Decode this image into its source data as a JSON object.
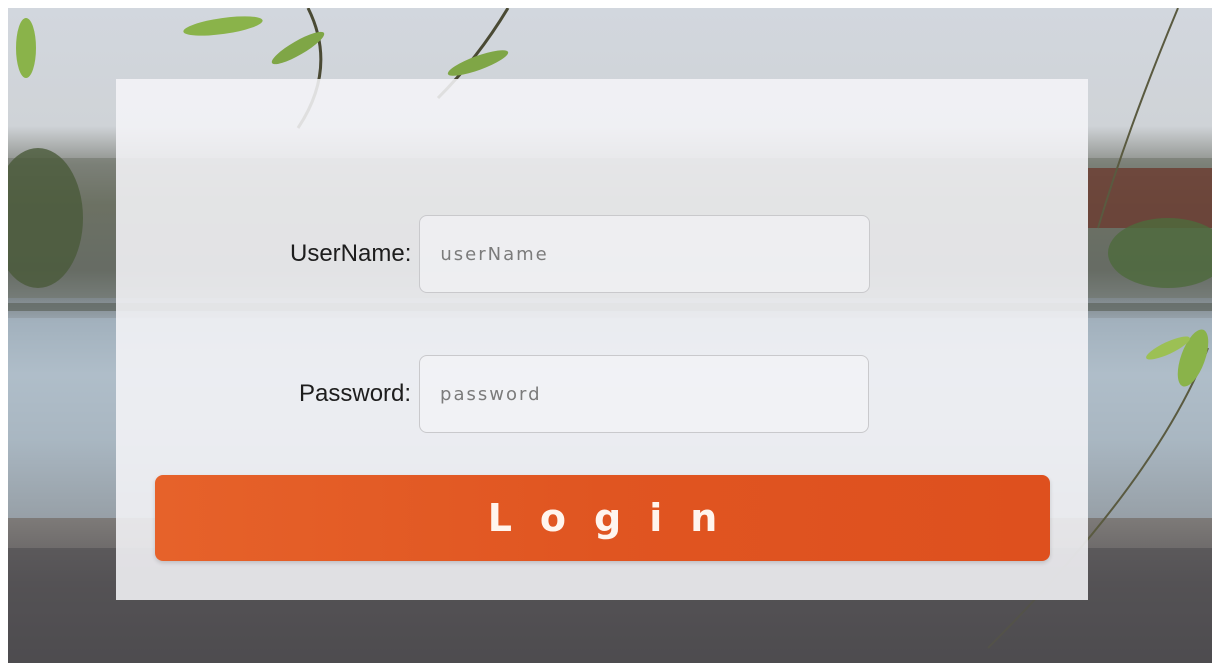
{
  "form": {
    "username_label": "UserName:",
    "username_placeholder": "userName",
    "password_label": "Password:",
    "password_placeholder": "password",
    "login_label": "Login"
  },
  "colors": {
    "login_button": "#e05521",
    "panel": "#f4f4f7"
  }
}
